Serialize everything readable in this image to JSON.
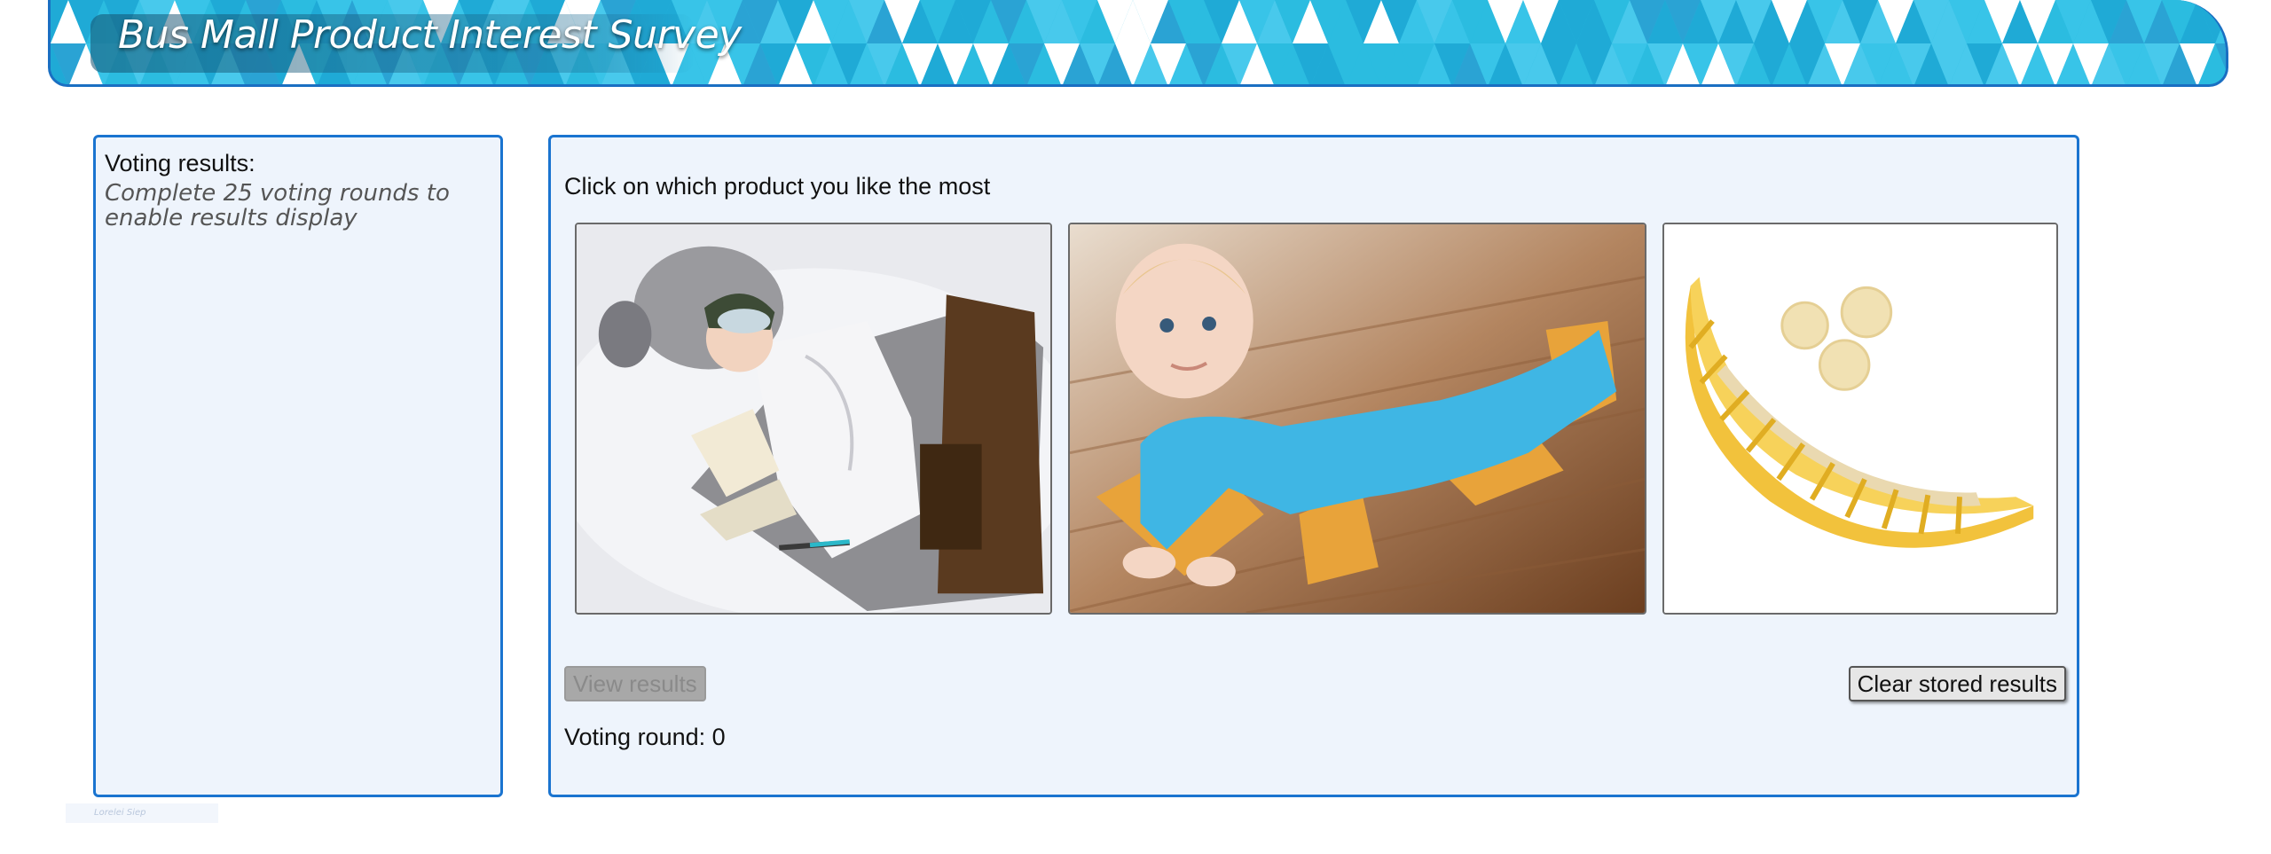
{
  "header": {
    "title": "Bus Mall Product Interest Survey"
  },
  "results": {
    "heading": "Voting results:",
    "note": "Complete 25 voting rounds to enable results display"
  },
  "survey": {
    "instructions": "Click on which product you like the most",
    "products": [
      {
        "icon": "tauntaun-sleeping-bag-image"
      },
      {
        "icon": "baby-sweeper-onesie-image"
      },
      {
        "icon": "banana-slicer-image"
      }
    ],
    "view_results_label": "View results",
    "view_results_enabled": false,
    "clear_label": "Clear stored results",
    "round_text": "Voting round: 0"
  },
  "footer": {
    "text": "Lorelei Siep"
  },
  "colors": {
    "accent": "#1a74d0",
    "panel_bg": "#eef4fc",
    "banner": "#2bbce0"
  }
}
